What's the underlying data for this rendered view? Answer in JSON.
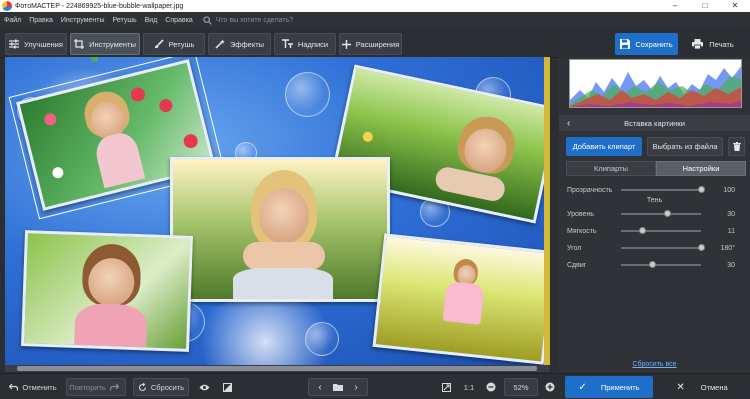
{
  "window": {
    "title": "ФотоМАСТЕР - 224869925-blue-bubble-wallpaper.jpg",
    "controls": [
      "–",
      "□",
      "✕"
    ]
  },
  "menu": {
    "items": [
      "Файл",
      "Правка",
      "Инструменты",
      "Ретушь",
      "Вид",
      "Справка"
    ],
    "search_placeholder": "Что вы хотите сделать?"
  },
  "toolbar": {
    "tabs": [
      {
        "label": "Улучшения",
        "icon": "sliders-icon"
      },
      {
        "label": "Инструменты",
        "icon": "crop-icon",
        "active": true
      },
      {
        "label": "Ретушь",
        "icon": "brush-icon"
      },
      {
        "label": "Эффекты",
        "icon": "magic-wand-icon"
      },
      {
        "label": "Надписи",
        "icon": "text-icon"
      },
      {
        "label": "Расширения",
        "icon": "plus-icon"
      }
    ],
    "save_label": "Сохранить",
    "print_label": "Печать"
  },
  "panel": {
    "title": "Вставка картинки",
    "add_clipart_label": "Добавить клипарт",
    "choose_file_label": "Выбрать из файла",
    "segments": [
      "Клипарты",
      "Настройки"
    ],
    "active_segment": 1,
    "sliders": [
      {
        "label": "Прозрачность",
        "value": "100",
        "fraction": 1.0
      },
      {
        "label": "Уровень",
        "value": "30",
        "fraction": 0.3
      },
      {
        "label": "Мягкость",
        "value": "11",
        "fraction": 0.11
      },
      {
        "label": "Угол",
        "value": "180°",
        "fraction": 1.0
      },
      {
        "label": "Сдвиг",
        "value": "30",
        "fraction": 0.3
      }
    ],
    "shadow_label": "Тень",
    "reset_all_label": "Сбросить все"
  },
  "bottom": {
    "undo_label": "Отменить",
    "redo_label": "Повторить",
    "reset_label": "Сбросить",
    "zoom_1to1": "1:1",
    "zoom_value": "52%",
    "apply_label": "Применить",
    "cancel_label": "Отмена"
  },
  "colors": {
    "accent": "#1e6fc9",
    "panel_bg": "#2f3237",
    "link": "#6fb0ff"
  }
}
